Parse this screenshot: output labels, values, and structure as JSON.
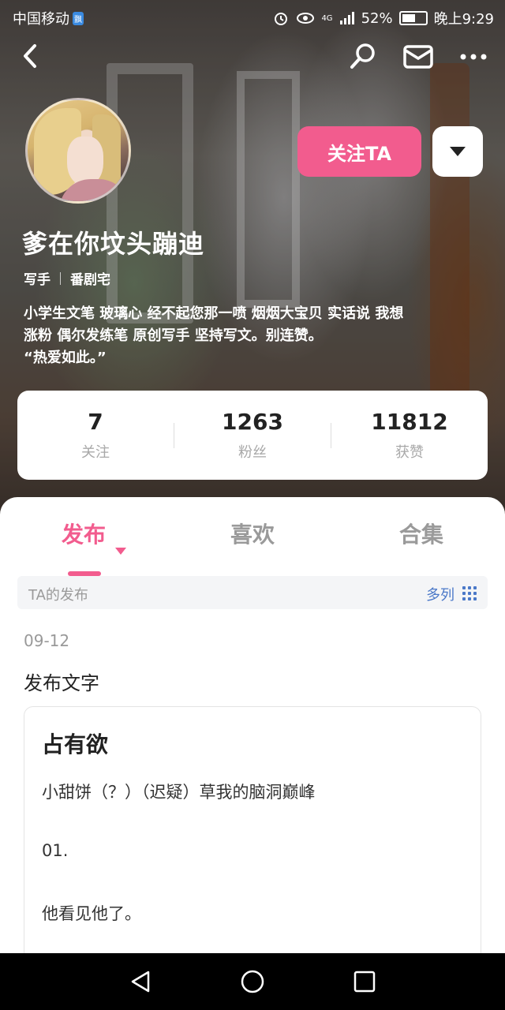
{
  "status_bar": {
    "carrier": "中国移动",
    "carrier_badge": "飘",
    "network": "4G",
    "battery": "52%",
    "time": "晚上9:29"
  },
  "nav": {
    "icons": [
      "back-icon",
      "search-icon",
      "mail-icon",
      "more-icon"
    ]
  },
  "profile": {
    "follow_label": "关注TA",
    "username": "爹在你坟头蹦迪",
    "tags": [
      "写手",
      "番剧宅"
    ],
    "bio_lines": [
      "小学生文笔 玻璃心 经不起您那一喷  烟烟大宝贝 实话说 我想",
      "涨粉 偶尔发练笔 原创写手 坚持写文。别连赞。",
      "“热爱如此。”"
    ]
  },
  "stats": [
    {
      "value": "7",
      "label": "关注"
    },
    {
      "value": "1263",
      "label": "粉丝"
    },
    {
      "value": "11812",
      "label": "获赞"
    }
  ],
  "tabs": [
    {
      "label": "发布",
      "active": true
    },
    {
      "label": "喜欢",
      "active": false
    },
    {
      "label": "合集",
      "active": false
    }
  ],
  "subbar": {
    "left": "TA的发布",
    "right": "多列"
  },
  "post": {
    "date": "09-12",
    "title": "发布文字",
    "card_title": "占有欲",
    "lines": [
      "小甜饼（？）（迟疑）草我的脑洞巅峰",
      "01.",
      "他看见他了。"
    ]
  },
  "colors": {
    "accent": "#f25c8e",
    "link": "#4a78c8"
  }
}
